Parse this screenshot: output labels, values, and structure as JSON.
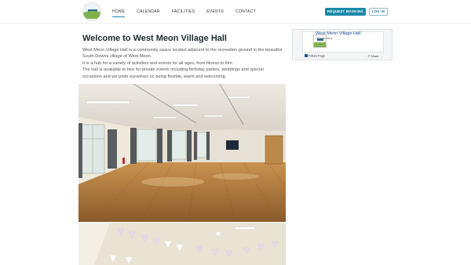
{
  "header": {
    "nav": [
      {
        "label": "HOME",
        "active": true
      },
      {
        "label": "CALENDAR",
        "active": false
      },
      {
        "label": "FACILITIES",
        "active": false
      },
      {
        "label": "EVENTS",
        "active": false
      },
      {
        "label": "CONTACT",
        "active": false
      }
    ],
    "request_booking_label": "REQUEST BOOKING",
    "login_label": "LOG IN"
  },
  "main": {
    "title": "Welcome to West Meon Village Hall",
    "paragraphs": [
      "West Meon Village Hall is a community space located adjacent to the recreation ground in the beautiful South Downs village of West Meon.",
      "It is a hub for a variety of activities and events for all ages, from fitness to film.",
      "The hall is available to hire for private events including birthday parties, weddings and special occasions and we pride ourselves on being flexible, warm and welcoming."
    ]
  },
  "facebook_widget": {
    "page_name": "West Meon Village Hall",
    "followers": "93 followers",
    "follow_label": "Follow Page",
    "share_label": "Share"
  },
  "colors": {
    "accent": "#1a8aa8",
    "title": "#1e2a2e",
    "link": "#1a4e9a"
  }
}
